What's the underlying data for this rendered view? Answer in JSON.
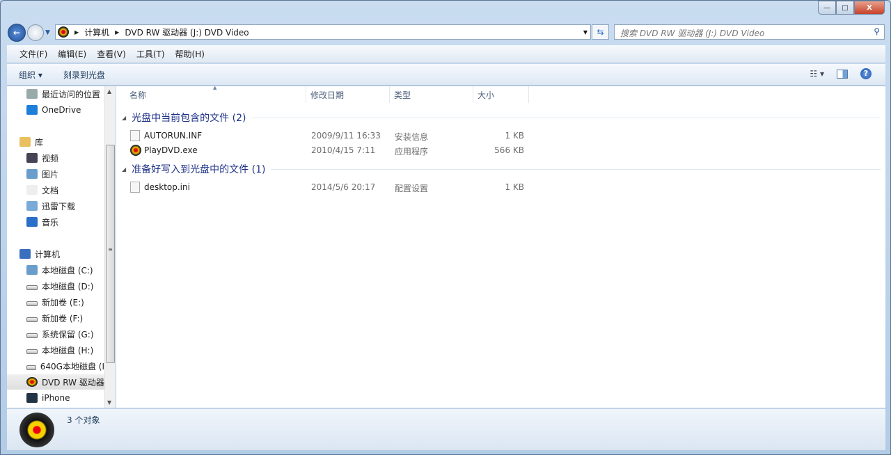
{
  "window": {
    "minimize": "—",
    "maximize": "□",
    "close": "X"
  },
  "address": {
    "crumbs": [
      "计算机",
      "DVD RW 驱动器 (J:) DVD Video"
    ],
    "refresh": "⇆"
  },
  "search": {
    "placeholder": "搜索 DVD RW 驱动器 (J:) DVD Video"
  },
  "menu": [
    "文件(F)",
    "编辑(E)",
    "查看(V)",
    "工具(T)",
    "帮助(H)"
  ],
  "toolbar": {
    "organize": "组织 ▾",
    "burn": "刻录到光盘",
    "views": "☷ ▾",
    "help": "?"
  },
  "sidebar": {
    "items": [
      {
        "label": "最近访问的位置",
        "icon": "recent-places-icon"
      },
      {
        "label": "OneDrive",
        "icon": "onedrive-icon"
      },
      {
        "label": "库",
        "icon": "library-icon"
      },
      {
        "label": "视频",
        "icon": "video-icon"
      },
      {
        "label": "图片",
        "icon": "pictures-icon"
      },
      {
        "label": "文档",
        "icon": "documents-icon"
      },
      {
        "label": "迅雷下载",
        "icon": "download-icon"
      },
      {
        "label": "音乐",
        "icon": "music-icon"
      },
      {
        "label": "计算机",
        "icon": "computer-icon"
      },
      {
        "label": "本地磁盘 (C:)",
        "icon": "system-drive-icon"
      },
      {
        "label": "本地磁盘 (D:)",
        "icon": "drive-icon"
      },
      {
        "label": "新加卷 (E:)",
        "icon": "drive-icon"
      },
      {
        "label": "新加卷 (F:)",
        "icon": "drive-icon"
      },
      {
        "label": "系统保留 (G:)",
        "icon": "drive-icon"
      },
      {
        "label": "本地磁盘 (H:)",
        "icon": "drive-icon"
      },
      {
        "label": "640G本地磁盘 (I",
        "icon": "drive-icon"
      },
      {
        "label": "DVD RW 驱动器",
        "icon": "dvd-drive-icon"
      },
      {
        "label": "iPhone",
        "icon": "iphone-icon"
      }
    ]
  },
  "columns": [
    "名称",
    "修改日期",
    "类型",
    "大小"
  ],
  "groups": [
    {
      "title": "光盘中当前包含的文件 (2)",
      "files": [
        {
          "name": "AUTORUN.INF",
          "date": "2009/9/11 16:33",
          "type": "安装信息",
          "size": "1 KB"
        },
        {
          "name": "PlayDVD.exe",
          "date": "2010/4/15 7:11",
          "type": "应用程序",
          "size": "566 KB"
        }
      ]
    },
    {
      "title": "准备好写入到光盘中的文件 (1)",
      "files": [
        {
          "name": "desktop.ini",
          "date": "2014/5/6 20:17",
          "type": "配置设置",
          "size": "1 KB"
        }
      ]
    }
  ],
  "status": {
    "count": "3 个对象"
  }
}
